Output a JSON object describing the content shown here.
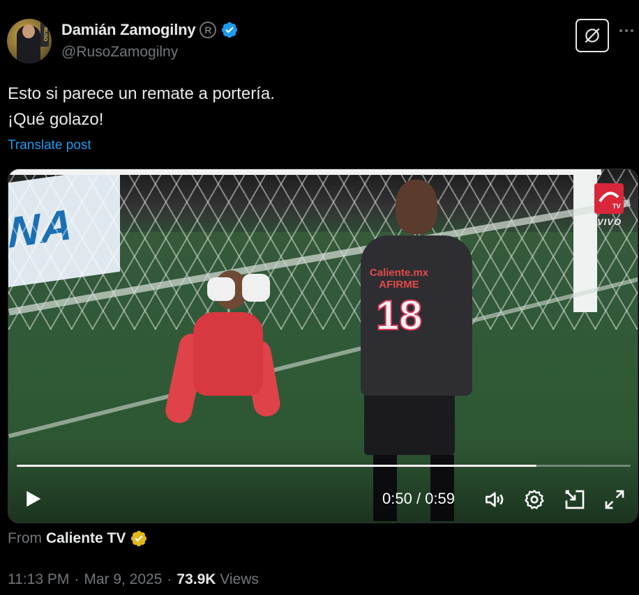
{
  "author": {
    "name": "Damián Zamogilny",
    "handle": "@RusoZamogilny",
    "avatar_tag": "RUSO"
  },
  "tweet": {
    "lines": [
      "Esto si parece un remate a portería.",
      "¡Qué golazo!"
    ],
    "translate_label": "Translate post"
  },
  "video": {
    "billboard_text": "NA",
    "player_number": "18",
    "player_sponsor": "Caliente.mx",
    "player_sponsor2": "AFIRME",
    "channel_label": "VIVO",
    "current_time": "0:50",
    "separator": " / ",
    "duration": "0:59",
    "progress": 0.847
  },
  "source": {
    "from_label": "From",
    "source_name": "Caliente TV"
  },
  "meta": {
    "time": "11:13 PM",
    "dot1": "·",
    "date": "Mar 9, 2025",
    "dot2": "·",
    "views_count": "73.9K",
    "views_label": "Views"
  },
  "colors": {
    "accent": "#1d9bf0",
    "verified": "#1d9bf0",
    "gold_verified": "#e2b719"
  }
}
